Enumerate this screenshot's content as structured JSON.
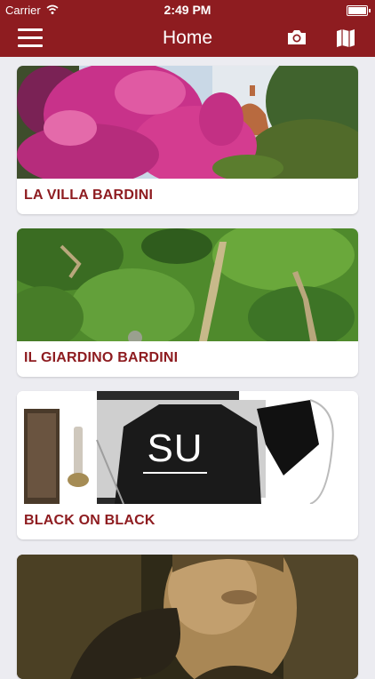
{
  "status_bar": {
    "carrier": "Carrier",
    "time": "2:49 PM"
  },
  "nav": {
    "title": "Home"
  },
  "icons": {
    "menu": "hamburger-menu-icon",
    "camera": "camera-icon",
    "map": "map-icon"
  },
  "cards": [
    {
      "label": "LA VILLA BARDINI"
    },
    {
      "label": "IL GIARDINO BARDINI"
    },
    {
      "label": "BLACK ON BLACK",
      "image_text": "SU"
    },
    {
      "label": ""
    }
  ],
  "colors": {
    "brand": "#8e1c20",
    "background": "#ececf1"
  }
}
